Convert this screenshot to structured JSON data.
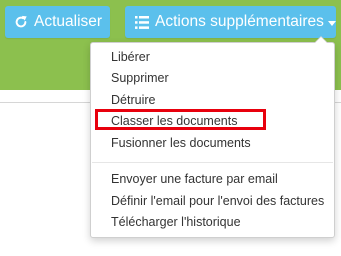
{
  "toolbar": {
    "refresh_label": "Actualiser",
    "refresh_icon": "refresh-icon",
    "actions_label": "Actions supplémentaires",
    "actions_icon": "list-icon"
  },
  "menu": {
    "items": [
      "Libérer",
      "Supprimer",
      "Détruire",
      "Classer les documents",
      "Fusionner les documents",
      "Envoyer une facture par email",
      "Définir l'email pour l'envoi des factures",
      "Télécharger l'historique"
    ],
    "highlighted_item": "Classer les documents"
  },
  "colors": {
    "button": "#5bc0ec",
    "header_band": "#8cc04e",
    "highlight": "#e8000d"
  }
}
